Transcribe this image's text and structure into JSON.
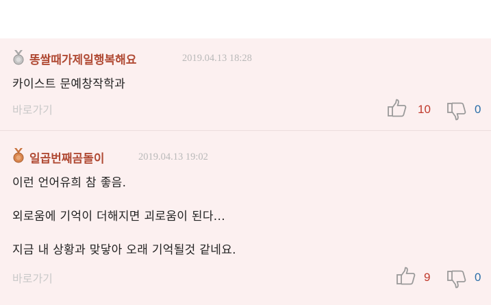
{
  "comments": [
    {
      "nickname": "똥쌀때가제일행복해요",
      "date": "2019.04.13 18:28",
      "medal": "silver-medal",
      "lines": [
        "카이스트 문예창작학과"
      ],
      "reply_label": "바로가기",
      "likes": "10",
      "dislikes": "0"
    },
    {
      "nickname": "일곱번째곰돌이",
      "date": "2019.04.13 19:02",
      "medal": "bronze-medal",
      "lines": [
        "이런 언어유희 참 좋음.",
        "외로움에 기억이 더해지면 괴로움이 된다...",
        "지금 내 상황과 맞닿아 오래 기억될것 같네요."
      ],
      "reply_label": "바로가기",
      "likes": "9",
      "dislikes": "0"
    }
  ],
  "colors": {
    "nickname": "#b04a34",
    "like_count": "#c0392b",
    "dislike_count": "#2a6ea8",
    "background": "#fcf0f0"
  },
  "icons": {
    "like": "thumbs-up-icon",
    "dislike": "thumbs-down-icon"
  }
}
